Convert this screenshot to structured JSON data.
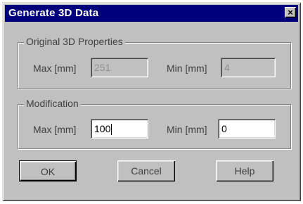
{
  "window": {
    "title": "Generate 3D Data",
    "close_glyph": "×"
  },
  "original": {
    "title": "Original 3D Properties",
    "max_label": "Max [mm]",
    "max_value": "251",
    "min_label": "Min [mm]",
    "min_value": "4"
  },
  "modification": {
    "title": "Modification",
    "max_label": "Max [mm]",
    "max_value": "100",
    "min_label": "Min [mm]",
    "min_value": "0"
  },
  "buttons": {
    "ok": "OK",
    "cancel": "Cancel",
    "help": "Help"
  }
}
